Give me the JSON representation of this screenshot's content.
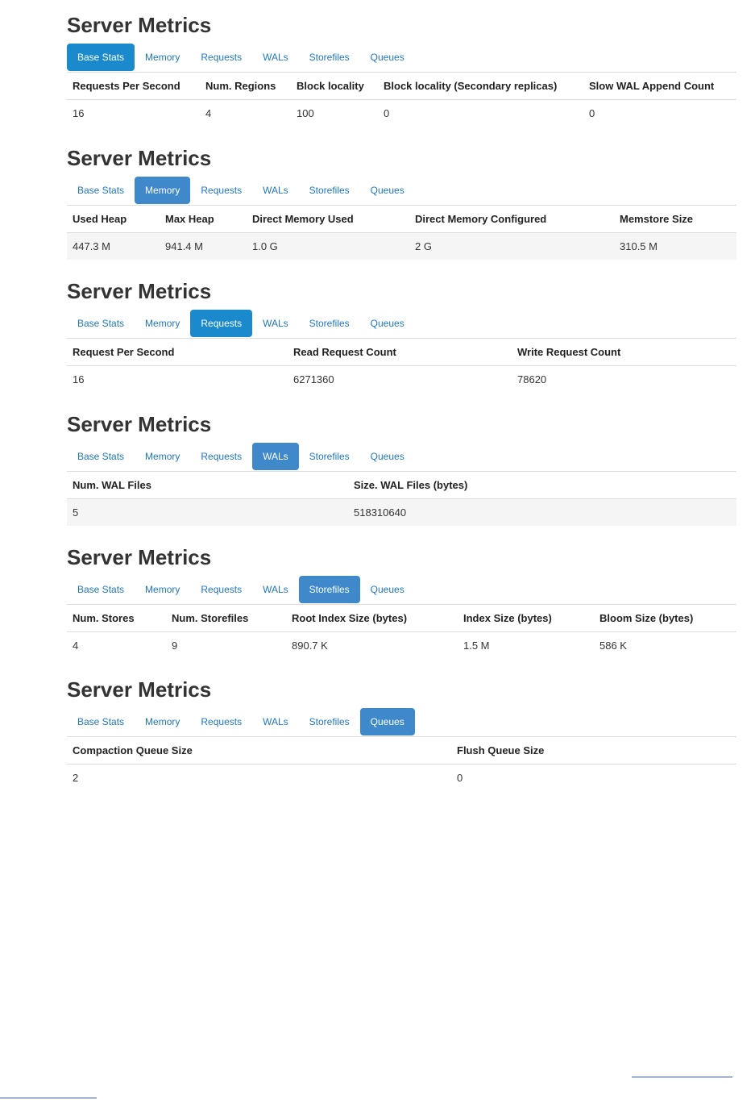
{
  "sections": [
    {
      "title": "Server Metrics",
      "tabs": [
        "Base Stats",
        "Memory",
        "Requests",
        "WALs",
        "Storefiles",
        "Queues"
      ],
      "active_tab": "Base Stats",
      "headers": [
        "Requests Per Second",
        "Num. Regions",
        "Block locality",
        "Block locality (Secondary replicas)",
        "Slow WAL Append Count"
      ],
      "values": [
        "16",
        "4",
        "100",
        "0",
        "0"
      ]
    },
    {
      "title": "Server Metrics",
      "tabs": [
        "Base Stats",
        "Memory",
        "Requests",
        "WALs",
        "Storefiles",
        "Queues"
      ],
      "active_tab": "Memory",
      "headers": [
        "Used Heap",
        "Max Heap",
        "Direct Memory Used",
        "Direct Memory Configured",
        "Memstore Size"
      ],
      "values": [
        "447.3 M",
        "941.4 M",
        "1.0 G",
        "2 G",
        "310.5 M"
      ]
    },
    {
      "title": "Server Metrics",
      "tabs": [
        "Base Stats",
        "Memory",
        "Requests",
        "WALs",
        "Storefiles",
        "Queues"
      ],
      "active_tab": "Requests",
      "headers": [
        "Request Per Second",
        "Read Request Count",
        "Write Request Count"
      ],
      "values": [
        "16",
        "6271360",
        "78620"
      ]
    },
    {
      "title": "Server Metrics",
      "tabs": [
        "Base Stats",
        "Memory",
        "Requests",
        "WALs",
        "Storefiles",
        "Queues"
      ],
      "active_tab": "WALs",
      "headers": [
        "Num. WAL Files",
        "Size. WAL Files (bytes)"
      ],
      "values": [
        "5",
        "518310640"
      ]
    },
    {
      "title": "Server Metrics",
      "tabs": [
        "Base Stats",
        "Memory",
        "Requests",
        "WALs",
        "Storefiles",
        "Queues"
      ],
      "active_tab": "Storefiles",
      "headers": [
        "Num. Stores",
        "Num. Storefiles",
        "Root Index Size (bytes)",
        "Index Size (bytes)",
        "Bloom Size (bytes)"
      ],
      "values": [
        "4",
        "9",
        "890.7 K",
        "1.5 M",
        "586 K"
      ]
    },
    {
      "title": "Server Metrics",
      "tabs": [
        "Base Stats",
        "Memory",
        "Requests",
        "WALs",
        "Storefiles",
        "Queues"
      ],
      "active_tab": "Queues",
      "headers": [
        "Compaction Queue Size",
        "Flush Queue Size"
      ],
      "values": [
        "2",
        "0"
      ]
    }
  ],
  "colors": {
    "active_tab": "#3f88c9",
    "active_tab_bright": "#1b8acd",
    "tab_link": "#1f77c1",
    "striped_row": "#f5f5f5",
    "footer_link": "#2a4fd8"
  }
}
